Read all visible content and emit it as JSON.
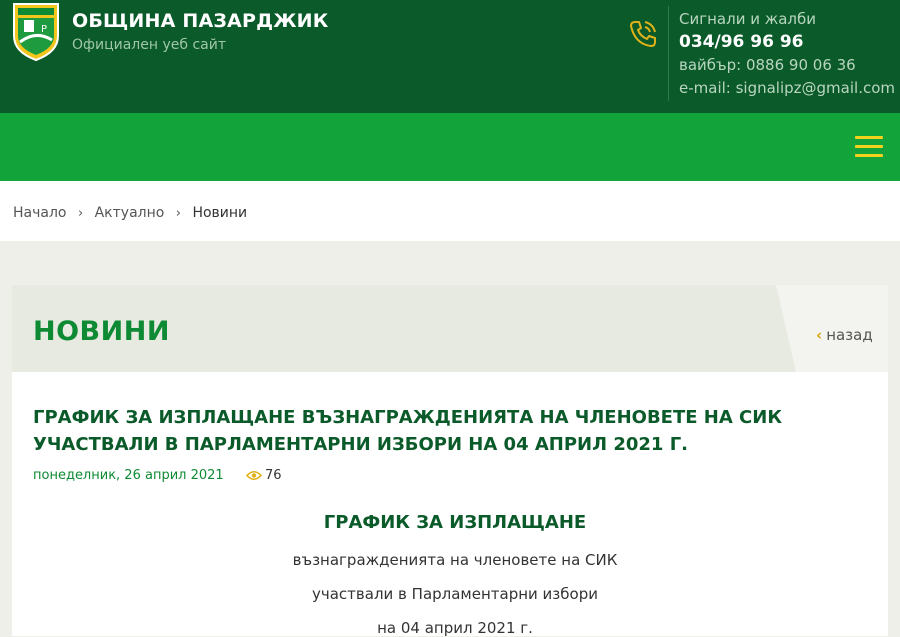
{
  "header": {
    "site_title": "ОБЩИНА ПАЗАРДЖИК",
    "site_subtitle": "Официален уеб сайт",
    "logo_icon": "municipality-crest-icon",
    "contact": {
      "label": "Сигнали и жалби",
      "phone": "034/96 96 96",
      "viber": "вайбър: 0886 90 06 36",
      "email": "e-mail: signalipz@gmail.com",
      "icon": "phone-icon"
    }
  },
  "nav": {
    "menu_icon": "hamburger-menu-icon",
    "menu_color": "#f2d21b"
  },
  "breadcrumb": {
    "items": [
      "Начало",
      "Актуално",
      "Новини"
    ],
    "separator_icon": "chevron-right-icon"
  },
  "page": {
    "title": "НОВИНИ",
    "back_label": "назад"
  },
  "article": {
    "title": "ГРАФИК ЗА ИЗПЛАЩАНЕ ВЪЗНАГРАЖДЕНИЯТА НА ЧЛЕНОВЕТЕ НА СИК УЧАСТВАЛИ В ПАРЛАМЕНТАРНИ ИЗБОРИ НА 04 АПРИЛ 2021 Г.",
    "date": "понеделник, 26 април 2021",
    "views": "76",
    "views_icon": "eye-icon",
    "body_heading": "ГРАФИК ЗА ИЗПЛАЩАНЕ",
    "body_lines": [
      "възнагражденията на членовете на СИК",
      "участвали в Парламентарни избори",
      "на 04 април 2021 г."
    ]
  },
  "colors": {
    "header_bg": "#0b5a2a",
    "nav_bg": "#12a33a",
    "accent_green": "#0e8a34",
    "accent_yellow": "#d8a514"
  }
}
